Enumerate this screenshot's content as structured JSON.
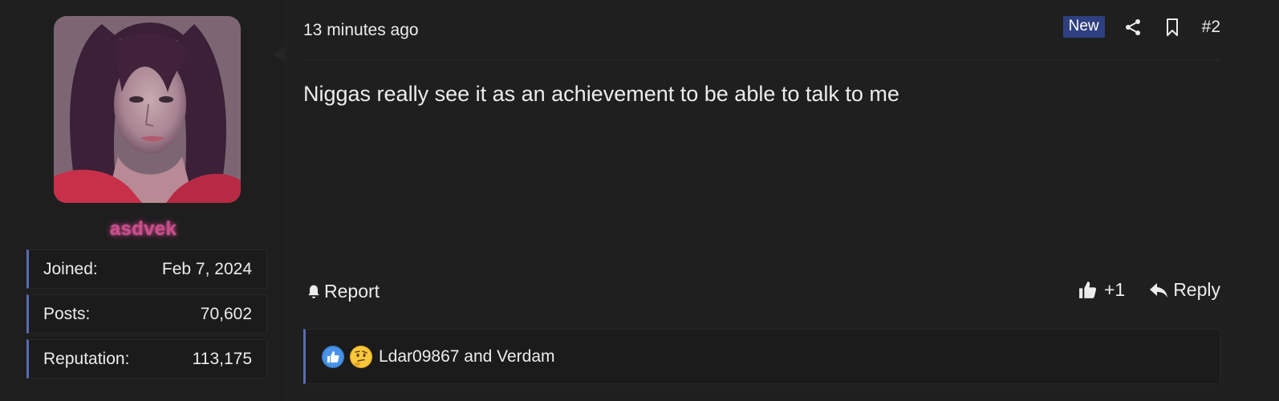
{
  "user": {
    "username": "asdvek",
    "avatar_icon": "user-avatar-photo",
    "username_color": "#c6508c",
    "stats": [
      {
        "label": "Joined:",
        "value": "Feb 7, 2024"
      },
      {
        "label": "Posts:",
        "value": "70,602"
      },
      {
        "label": "Reputation:",
        "value": "113,175"
      }
    ]
  },
  "post": {
    "time": "13 minutes ago",
    "badge": "New",
    "number": "#2",
    "share_icon": "share-icon",
    "bookmark_icon": "bookmark-icon",
    "message": "Niggas really see it as an achievement to be able to talk to me",
    "report_label": "Report",
    "like_label": "+1",
    "reply_label": "Reply",
    "reactions_text": "Ldar09867 and Verdam",
    "reaction_icons": [
      "thumbs-up-reaction-icon",
      "thinking-face-reaction-icon"
    ]
  },
  "colors": {
    "accent": "#5a6bb5",
    "badge_bg": "#2f4080",
    "background": "#1f1f1f"
  }
}
